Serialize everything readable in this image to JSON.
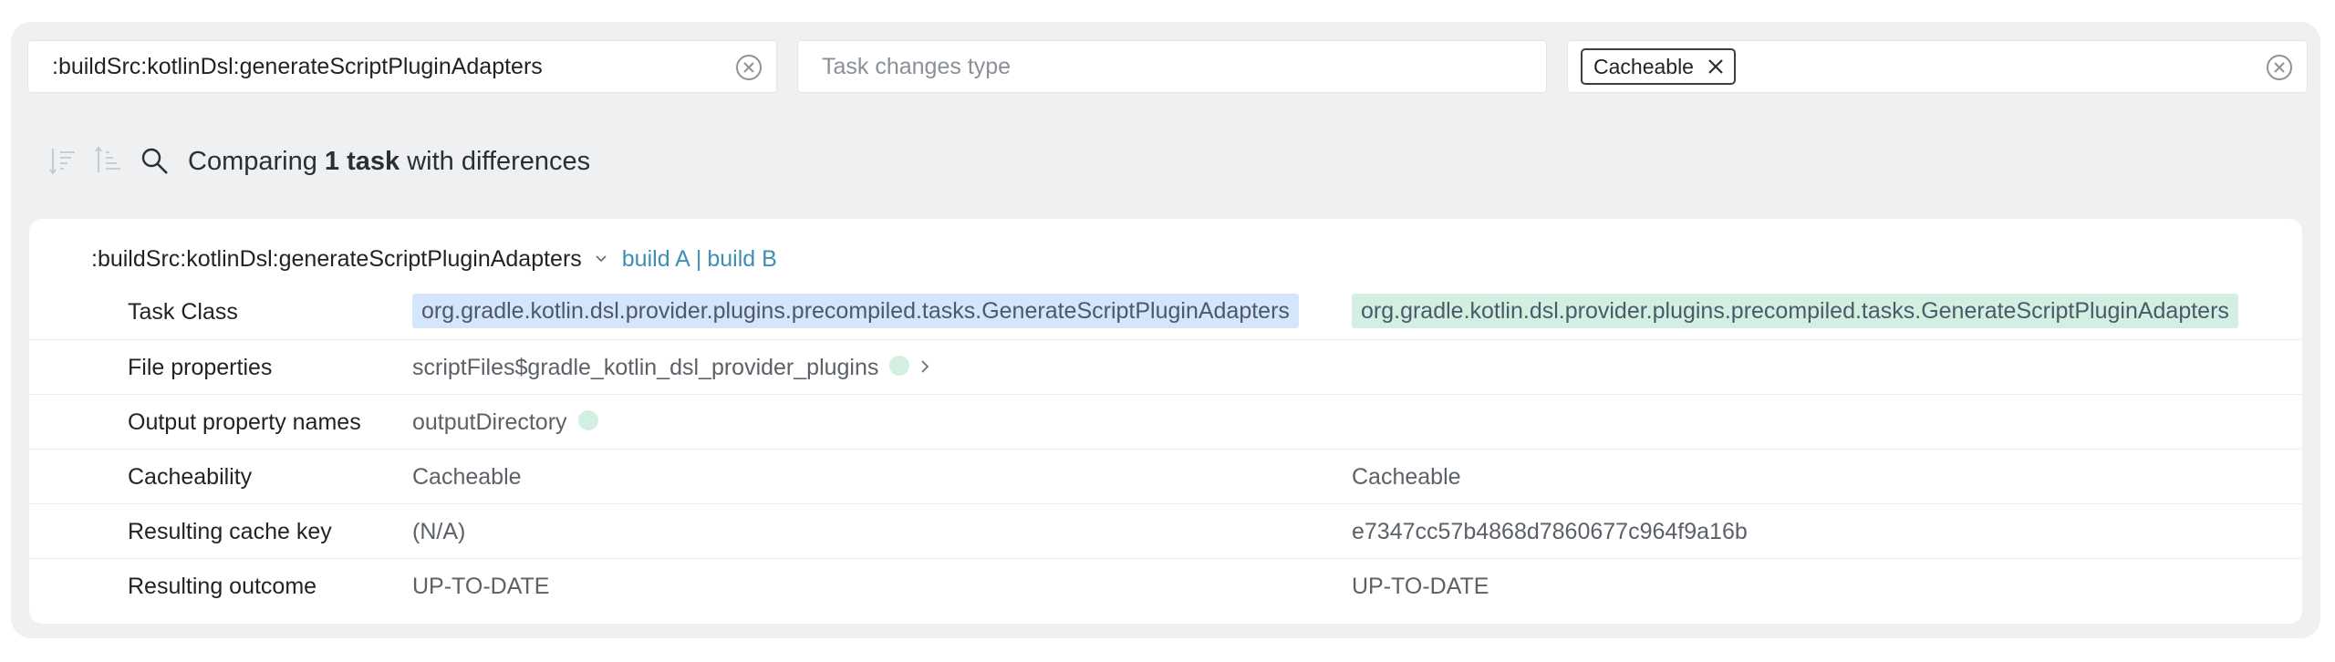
{
  "filters": {
    "task_path": {
      "value": ":buildSrc:kotlinDsl:generateScriptPluginAdapters"
    },
    "change_type": {
      "placeholder": "Task changes type"
    },
    "cacheability": {
      "chip": "Cacheable"
    }
  },
  "summary": {
    "prefix": "Comparing",
    "count": "1 task",
    "suffix": "with differences"
  },
  "task": {
    "name": ":buildSrc:kotlinDsl:generateScriptPluginAdapters",
    "build_a": "build A",
    "separator": "|",
    "build_b": "build B",
    "rows": {
      "task_class": {
        "label": "Task Class",
        "a": "org.gradle.kotlin.dsl.provider.plugins.precompiled.tasks.GenerateScriptPluginAdapters",
        "b": "org.gradle.kotlin.dsl.provider.plugins.precompiled.tasks.GenerateScriptPluginAdapters"
      },
      "file_properties": {
        "label": "File properties",
        "a": "scriptFiles$gradle_kotlin_dsl_provider_plugins"
      },
      "output_property_names": {
        "label": "Output property names",
        "a": "outputDirectory"
      },
      "cacheability": {
        "label": "Cacheability",
        "a": "Cacheable",
        "b": "Cacheable"
      },
      "cache_key": {
        "label": "Resulting cache key",
        "a": "(N/A)",
        "b": "e7347cc57b4868d7860677c964f9a16b"
      },
      "outcome": {
        "label": "Resulting outcome",
        "a": "UP-TO-DATE",
        "b": "UP-TO-DATE"
      }
    }
  },
  "colors": {
    "build_a_highlight": "#d5e5fb",
    "build_b_highlight": "#d3efe2",
    "link": "#3d8fb6"
  },
  "icons": [
    "clear-icon",
    "close-icon",
    "sort-descending-icon",
    "sort-ascending-icon",
    "search-icon",
    "chevron-down-icon",
    "chevron-right-icon"
  ]
}
